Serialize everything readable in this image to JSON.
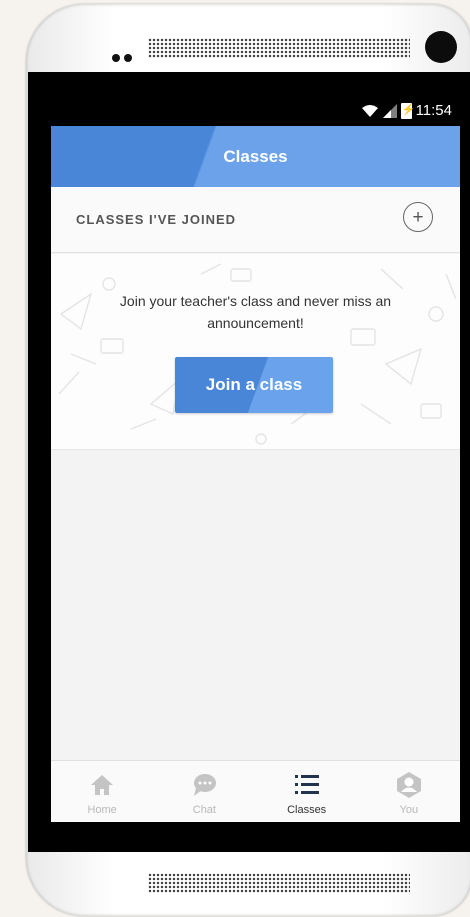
{
  "status_bar": {
    "time": "11:54",
    "icons": [
      "wifi-icon",
      "signal-icon",
      "battery-charging-icon"
    ]
  },
  "app_bar": {
    "title": "Classes"
  },
  "section": {
    "title": "CLASSES I'VE JOINED",
    "add_icon": "plus-circle-icon"
  },
  "empty_state": {
    "message": "Join your teacher's class and never miss an announcement!",
    "button_label": "Join a class"
  },
  "tabs": [
    {
      "label": "Home",
      "icon": "home-icon",
      "active": false
    },
    {
      "label": "Chat",
      "icon": "chat-icon",
      "active": false
    },
    {
      "label": "Classes",
      "icon": "list-icon",
      "active": true
    },
    {
      "label": "You",
      "icon": "user-icon",
      "active": false
    }
  ],
  "colors": {
    "primary": "#4a86d8",
    "primary_light": "#6ba2ea",
    "tab_active": "#22334d",
    "tab_inactive": "#c4c4c4"
  }
}
